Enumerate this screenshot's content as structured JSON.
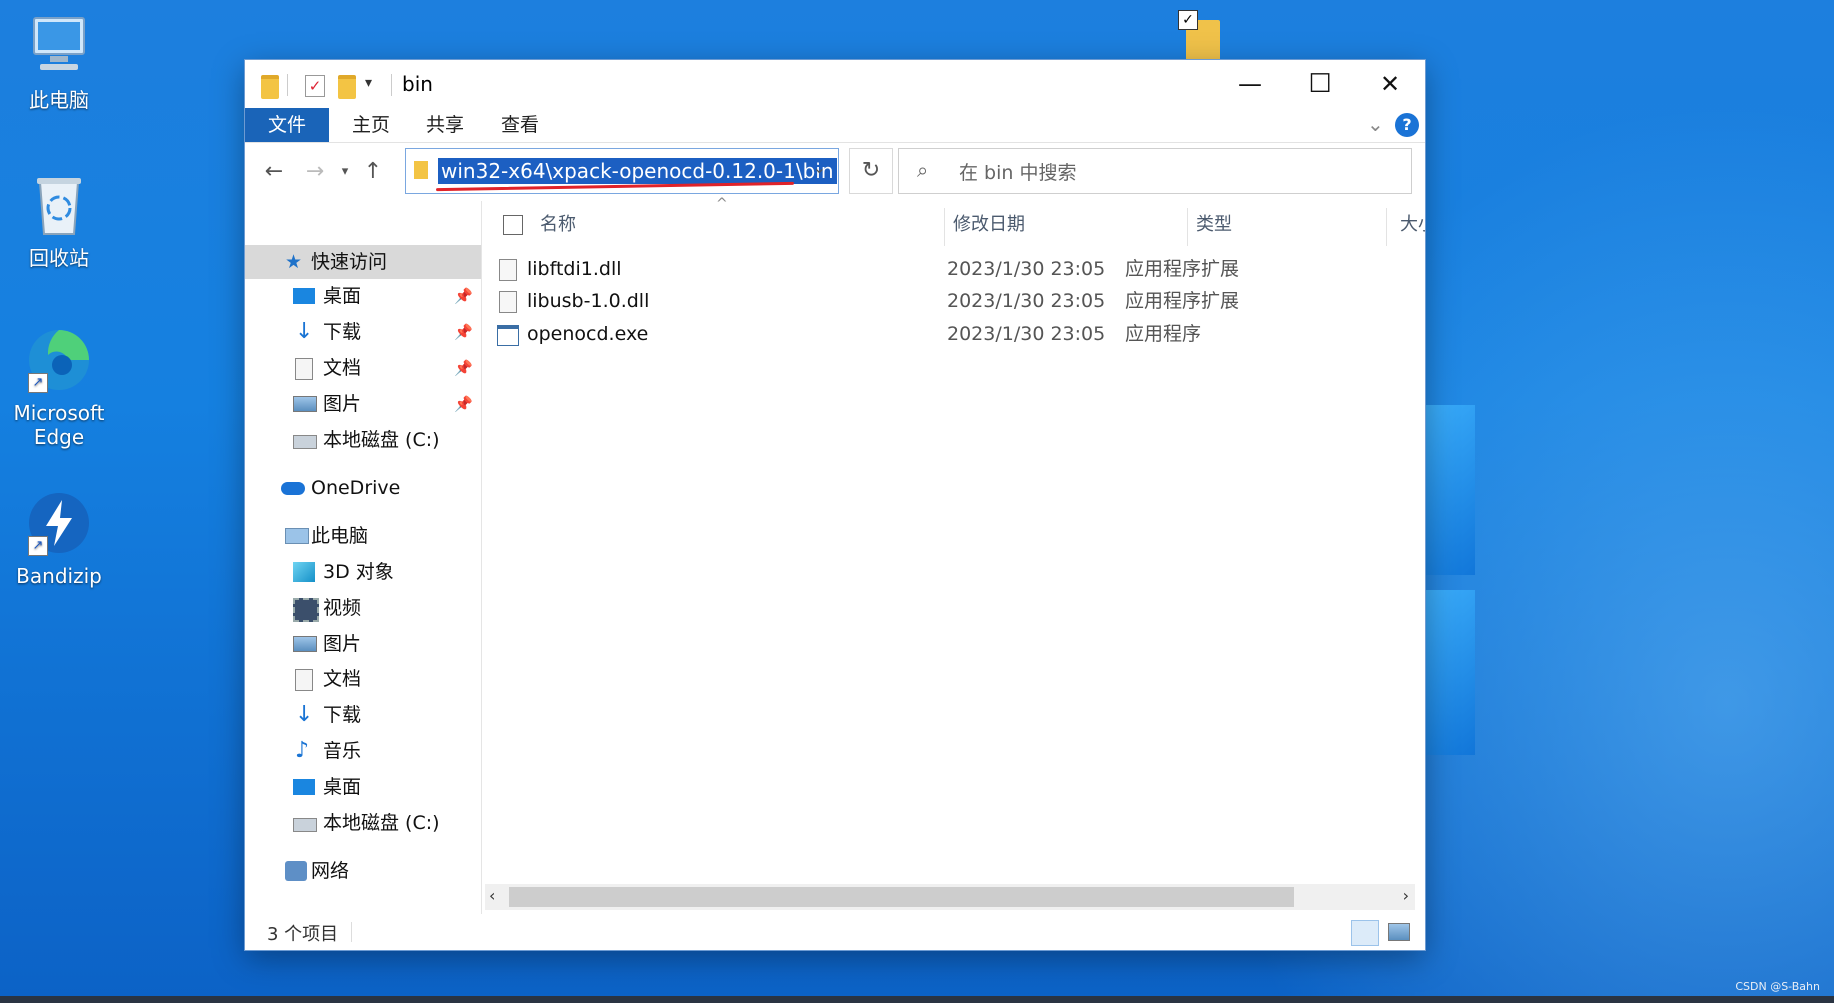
{
  "desktop": {
    "icons": [
      {
        "label": "此电脑"
      },
      {
        "label": "回收站"
      },
      {
        "label": "Microsoft Edge"
      },
      {
        "label": "Bandizip"
      }
    ],
    "watermark": "CSDN @S-Bahn"
  },
  "window": {
    "title": "bin",
    "controls": {
      "minimize": "—",
      "maximize": "☐",
      "close": "✕"
    },
    "ribbon_tabs": [
      {
        "label": "文件"
      },
      {
        "label": "主页"
      },
      {
        "label": "共享"
      },
      {
        "label": "查看"
      }
    ],
    "help_label": "?",
    "address": "win32-x64\\xpack-openocd-0.12.0-1\\bin",
    "search_placeholder": "在 bin 中搜索",
    "navigation": {
      "quick_access": "快速访问",
      "quick_items": [
        {
          "label": "桌面"
        },
        {
          "label": "下载"
        },
        {
          "label": "文档"
        },
        {
          "label": "图片"
        },
        {
          "label": "本地磁盘 (C:)"
        }
      ],
      "onedrive": "OneDrive",
      "this_pc": "此电脑",
      "pc_items": [
        {
          "label": "3D 对象"
        },
        {
          "label": "视频"
        },
        {
          "label": "图片"
        },
        {
          "label": "文档"
        },
        {
          "label": "下载"
        },
        {
          "label": "音乐"
        },
        {
          "label": "桌面"
        },
        {
          "label": "本地磁盘 (C:)"
        }
      ],
      "network": "网络"
    },
    "columns": {
      "name": "名称",
      "date": "修改日期",
      "type": "类型",
      "size": "大小"
    },
    "files": [
      {
        "name": "libftdi1.dll",
        "date": "2023/1/30 23:05",
        "type": "应用程序扩展"
      },
      {
        "name": "libusb-1.0.dll",
        "date": "2023/1/30 23:05",
        "type": "应用程序扩展"
      },
      {
        "name": "openocd.exe",
        "date": "2023/1/30 23:05",
        "type": "应用程序"
      }
    ],
    "status": "3 个项目"
  }
}
